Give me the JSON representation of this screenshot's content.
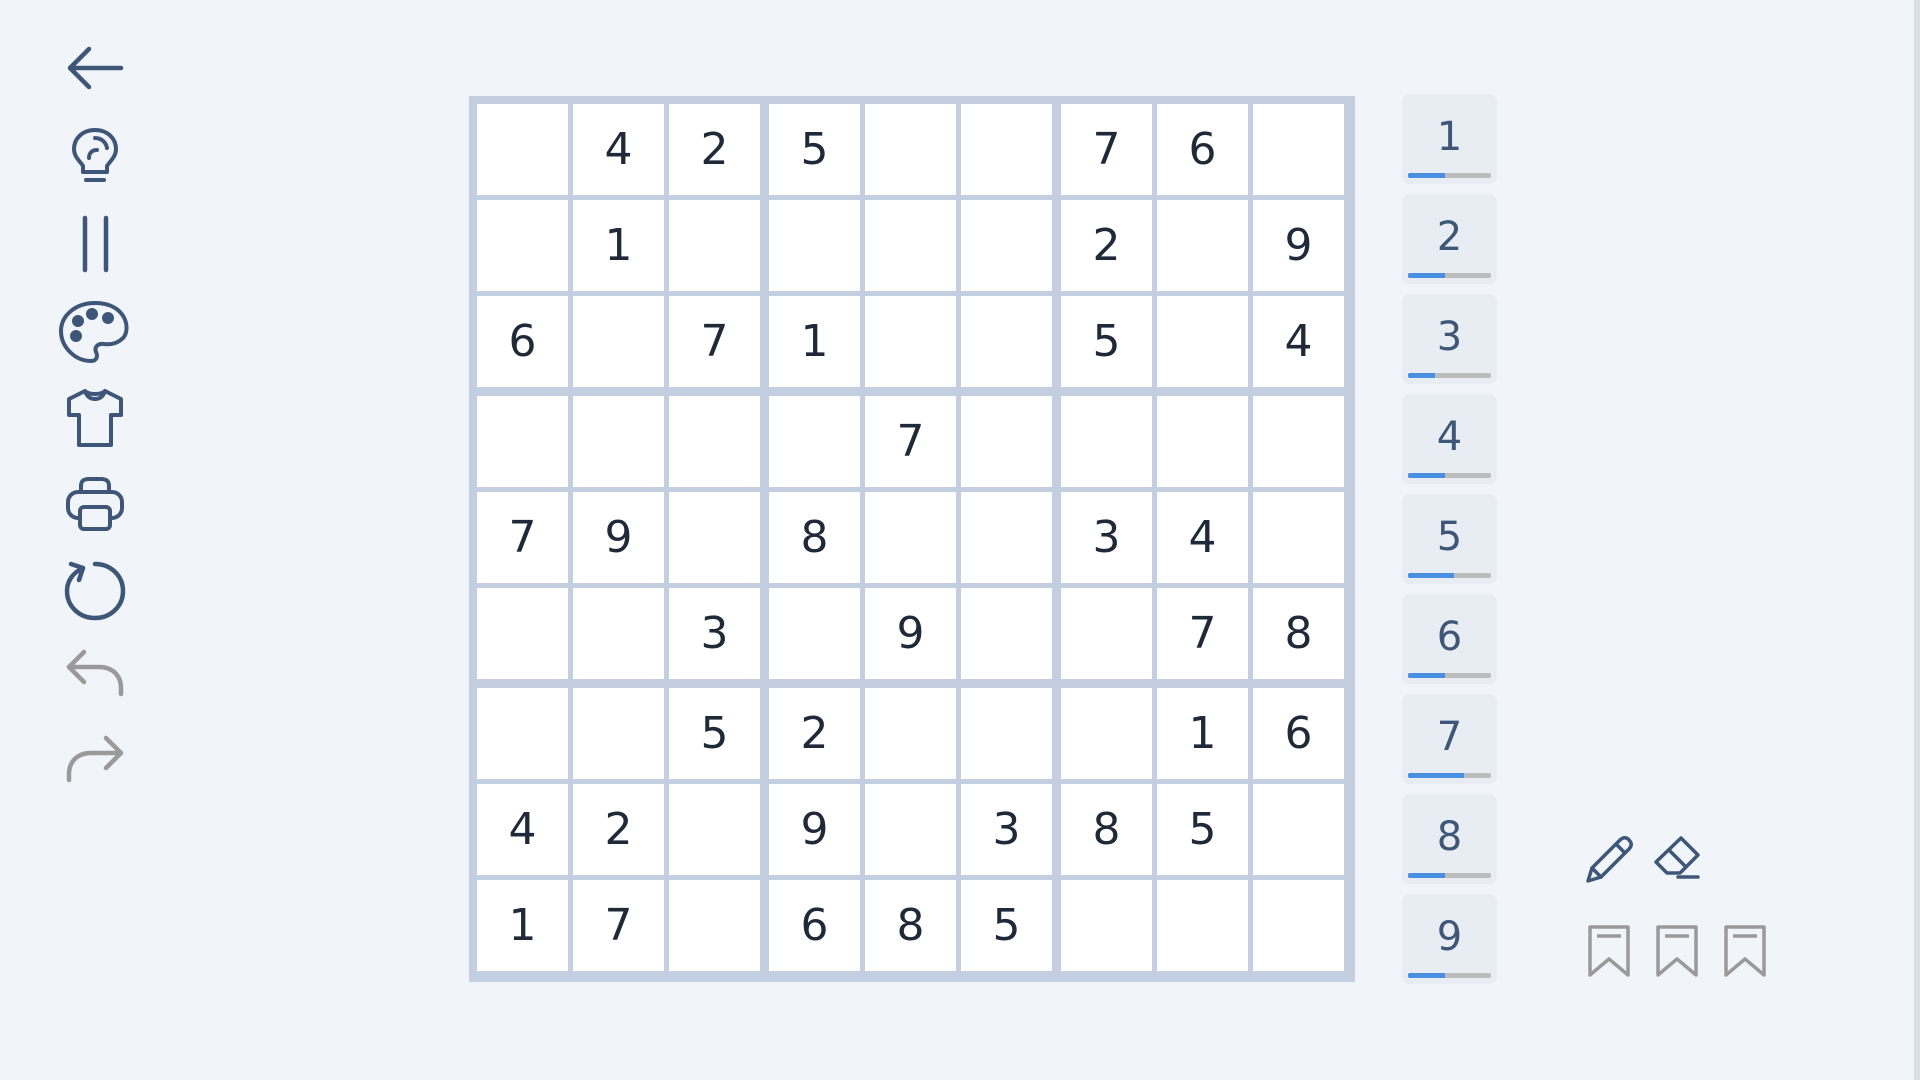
{
  "toolbar": {
    "items": [
      {
        "name": "back-arrow-icon",
        "enabled": true
      },
      {
        "name": "lightbulb-icon",
        "enabled": true
      },
      {
        "name": "pause-icon",
        "enabled": true
      },
      {
        "name": "palette-icon",
        "enabled": true
      },
      {
        "name": "shirt-icon",
        "enabled": true
      },
      {
        "name": "printer-icon",
        "enabled": true
      },
      {
        "name": "restart-icon",
        "enabled": true
      },
      {
        "name": "undo-icon",
        "enabled": false
      },
      {
        "name": "redo-icon",
        "enabled": false
      }
    ]
  },
  "board": {
    "grid": [
      [
        "",
        "4",
        "2",
        "5",
        "",
        "",
        "7",
        "6",
        ""
      ],
      [
        "",
        "1",
        "",
        "",
        "",
        "",
        "2",
        "",
        "9"
      ],
      [
        "6",
        "",
        "7",
        "1",
        "",
        "",
        "5",
        "",
        "4"
      ],
      [
        "",
        "",
        "",
        "",
        "7",
        "",
        "",
        "",
        ""
      ],
      [
        "7",
        "9",
        "",
        "8",
        "",
        "",
        "3",
        "4",
        ""
      ],
      [
        "",
        "",
        "3",
        "",
        "9",
        "",
        "",
        "7",
        "8"
      ],
      [
        "",
        "",
        "5",
        "2",
        "",
        "",
        "",
        "1",
        "6"
      ],
      [
        "4",
        "2",
        "",
        "9",
        "",
        "3",
        "8",
        "5",
        ""
      ],
      [
        "1",
        "7",
        "",
        "6",
        "8",
        "5",
        "",
        "",
        ""
      ]
    ]
  },
  "numpad": {
    "keys": [
      {
        "label": "1",
        "progress": 0.44
      },
      {
        "label": "2",
        "progress": 0.44
      },
      {
        "label": "3",
        "progress": 0.33
      },
      {
        "label": "4",
        "progress": 0.44
      },
      {
        "label": "5",
        "progress": 0.56
      },
      {
        "label": "6",
        "progress": 0.44
      },
      {
        "label": "7",
        "progress": 0.67
      },
      {
        "label": "8",
        "progress": 0.44
      },
      {
        "label": "9",
        "progress": 0.44
      }
    ]
  },
  "tools": {
    "items": [
      "pencil-icon",
      "eraser-icon"
    ],
    "bookmarks": [
      "bookmark-icon",
      "bookmark-icon",
      "bookmark-icon"
    ]
  },
  "colors": {
    "accent": "#4a90e2",
    "icon": "#3e5677",
    "icon_disabled": "#9a9a9a",
    "grid_line": "#c3cfe0"
  }
}
